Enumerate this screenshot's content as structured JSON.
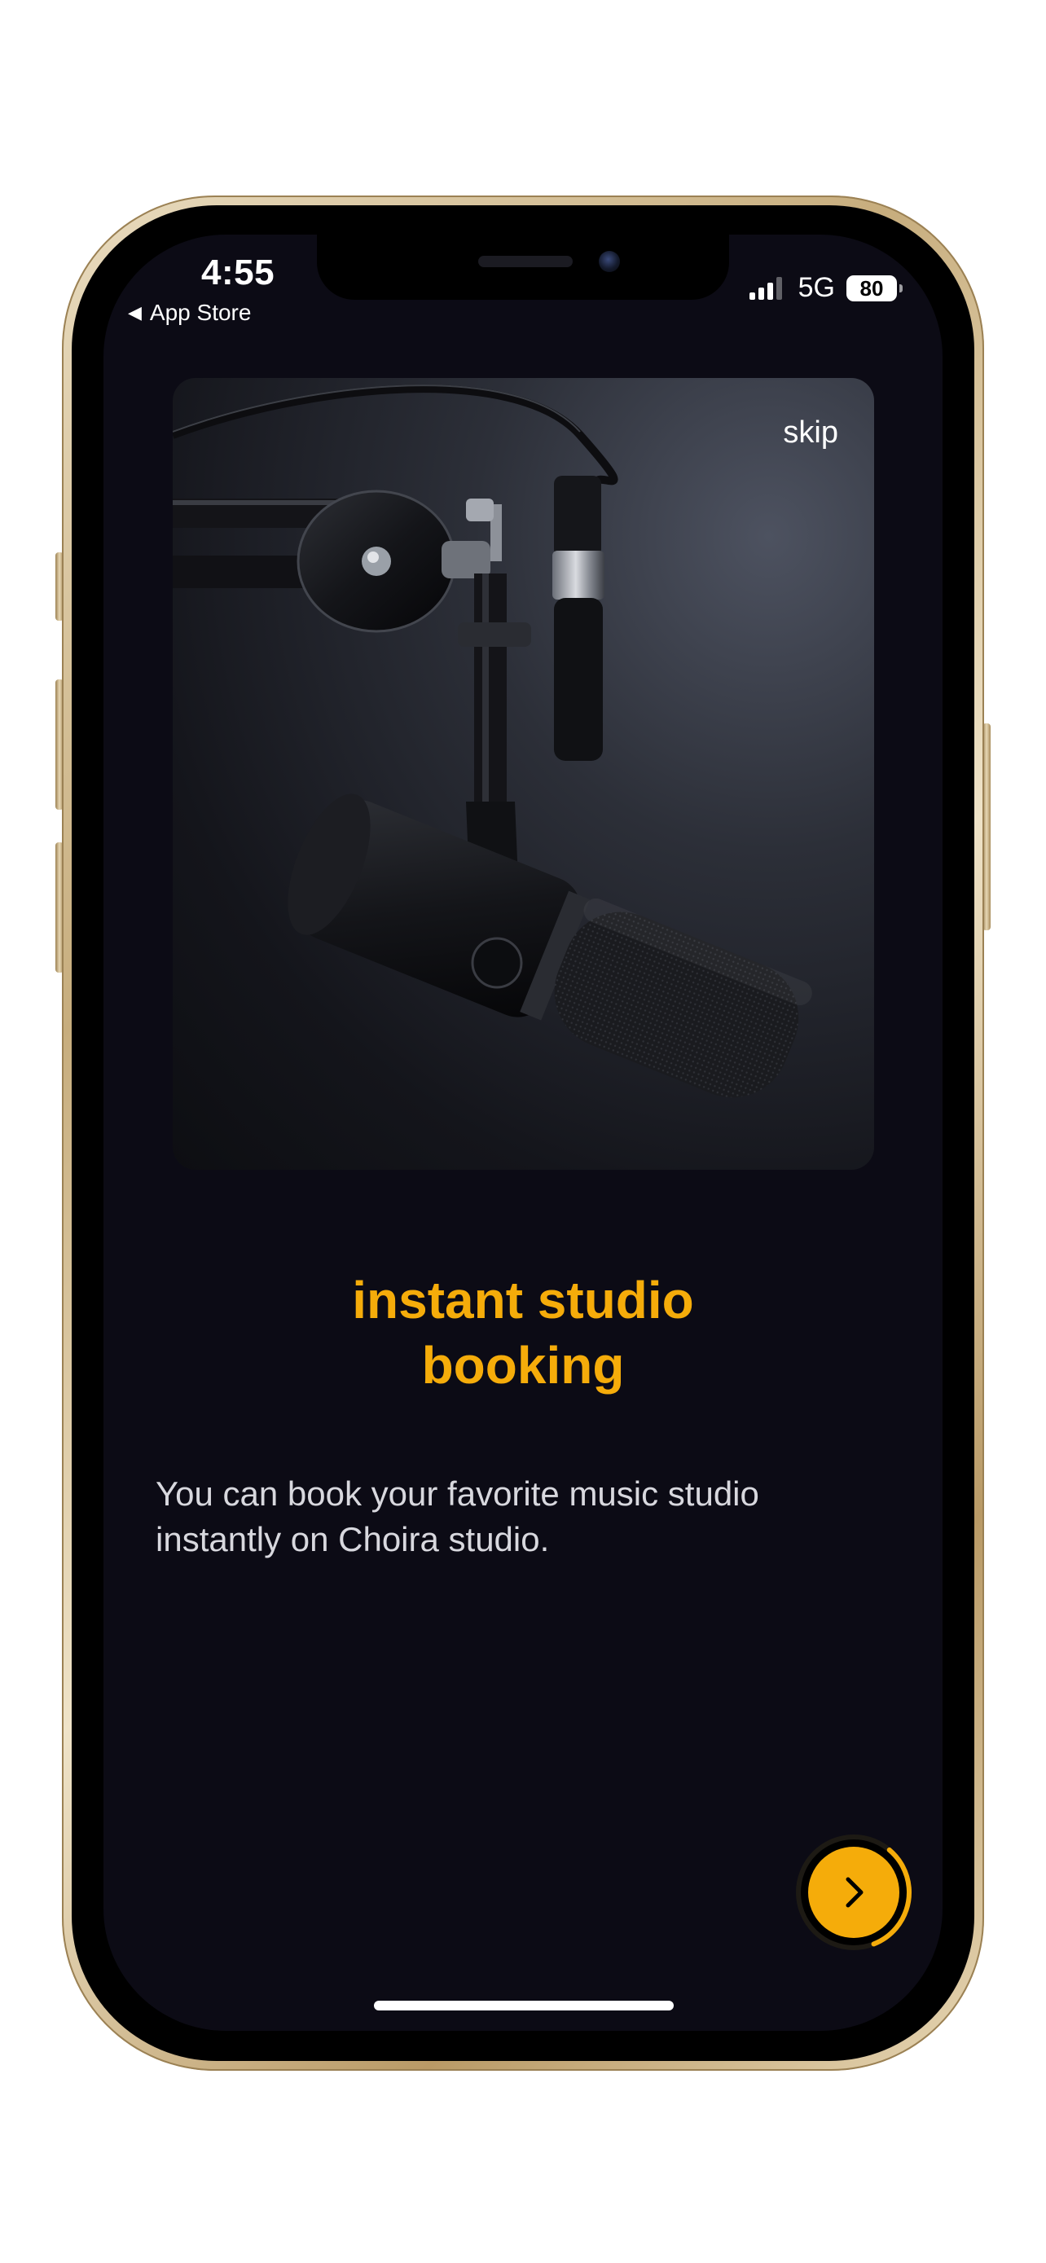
{
  "status_bar": {
    "time": "4:55",
    "back_label": "App Store",
    "network": "5G",
    "battery": "80"
  },
  "onboarding": {
    "skip_label": "skip",
    "title": "instant studio\nbooking",
    "description": "You can book your favorite music studio instantly on Choira studio.",
    "progress_fraction": 0.33,
    "image_subject": "studio microphone on boom arm"
  },
  "icons": {
    "back": "back-arrow-icon",
    "next": "chevron-right-icon",
    "signal": "cellular-signal-icon",
    "battery": "battery-icon"
  },
  "colors": {
    "background": "#0c0b15",
    "accent": "#f5ac0a",
    "text": "#d8d8de"
  }
}
